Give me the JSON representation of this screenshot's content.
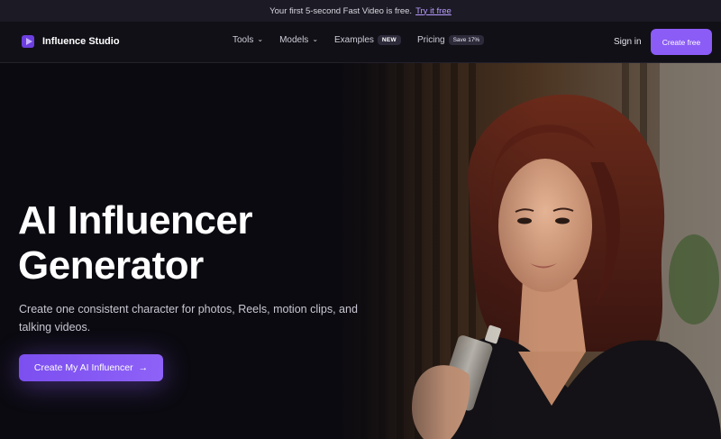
{
  "announcement": {
    "text": "Your first 5-second Fast Video is free.",
    "link": "Try it free"
  },
  "nav": {
    "brand": "Influence Studio",
    "items": [
      {
        "label": "Tools",
        "icon": "chevron-down-icon"
      },
      {
        "label": "Models",
        "icon": "chevron-down-icon"
      },
      {
        "label": "Examples",
        "badge": "NEW"
      },
      {
        "label": "Pricing",
        "badge": "Save 17%"
      }
    ],
    "signin": "Sign in",
    "create_free": "Create free"
  },
  "hero": {
    "title_line1": "AI Influencer",
    "title_line2": "Generator",
    "subtitle": "Create one consistent character for photos, Reels, motion clips, and talking videos.",
    "cta": "Create My AI Influencer",
    "cta_icon": "arrow-right-icon"
  },
  "colors": {
    "accent": "#8b5cf6",
    "background": "#0b0a10",
    "link": "#b69cff"
  }
}
